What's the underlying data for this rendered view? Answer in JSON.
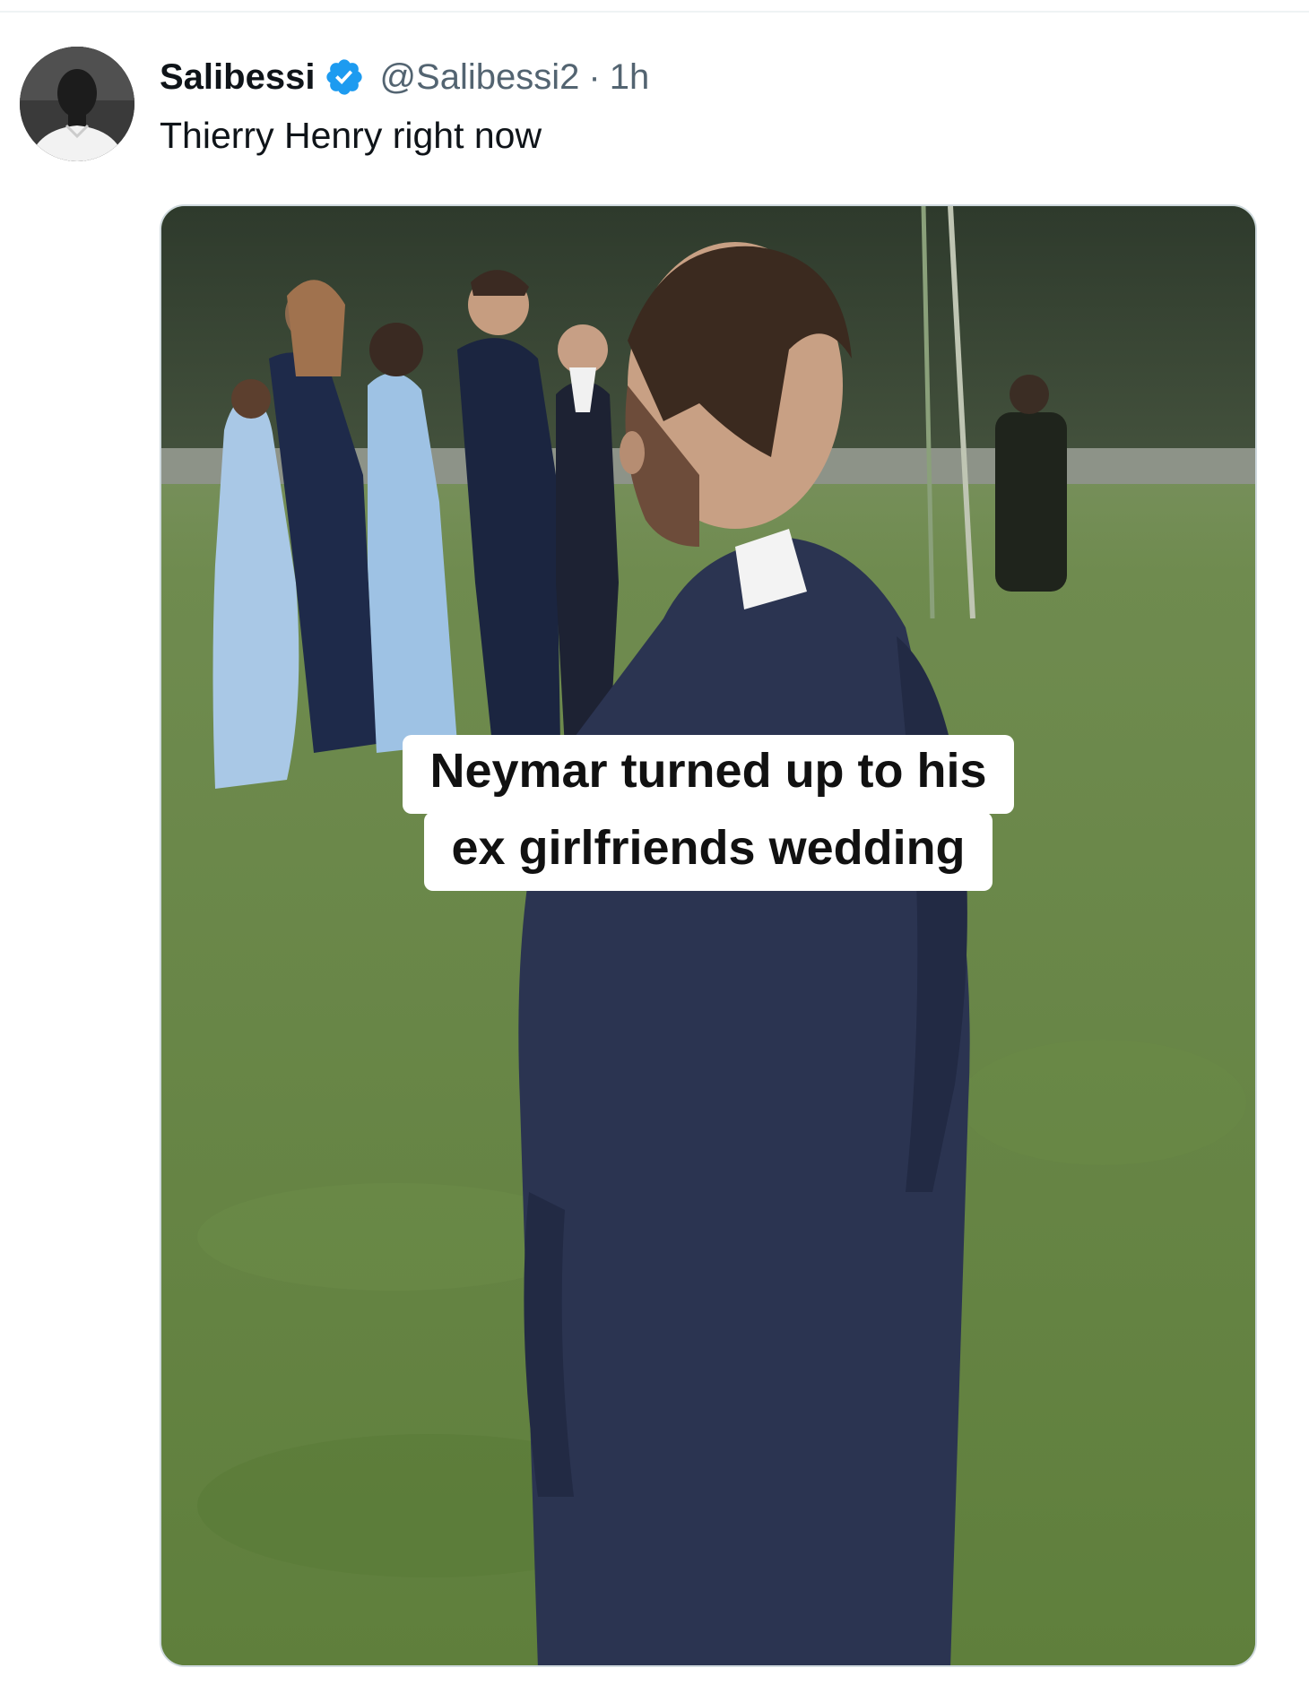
{
  "tweet": {
    "display_name": "Salibessi",
    "handle": "@Salibessi2",
    "separator": "·",
    "time": "1h",
    "text": "Thierry Henry right now",
    "verified": true,
    "verified_color": "#1d9bf0"
  },
  "media": {
    "caption_lines": [
      "Neymar turned up to his",
      "ex girlfriends wedding"
    ]
  },
  "icons": {
    "verified": "verified-badge-icon",
    "avatar": "profile-avatar"
  }
}
